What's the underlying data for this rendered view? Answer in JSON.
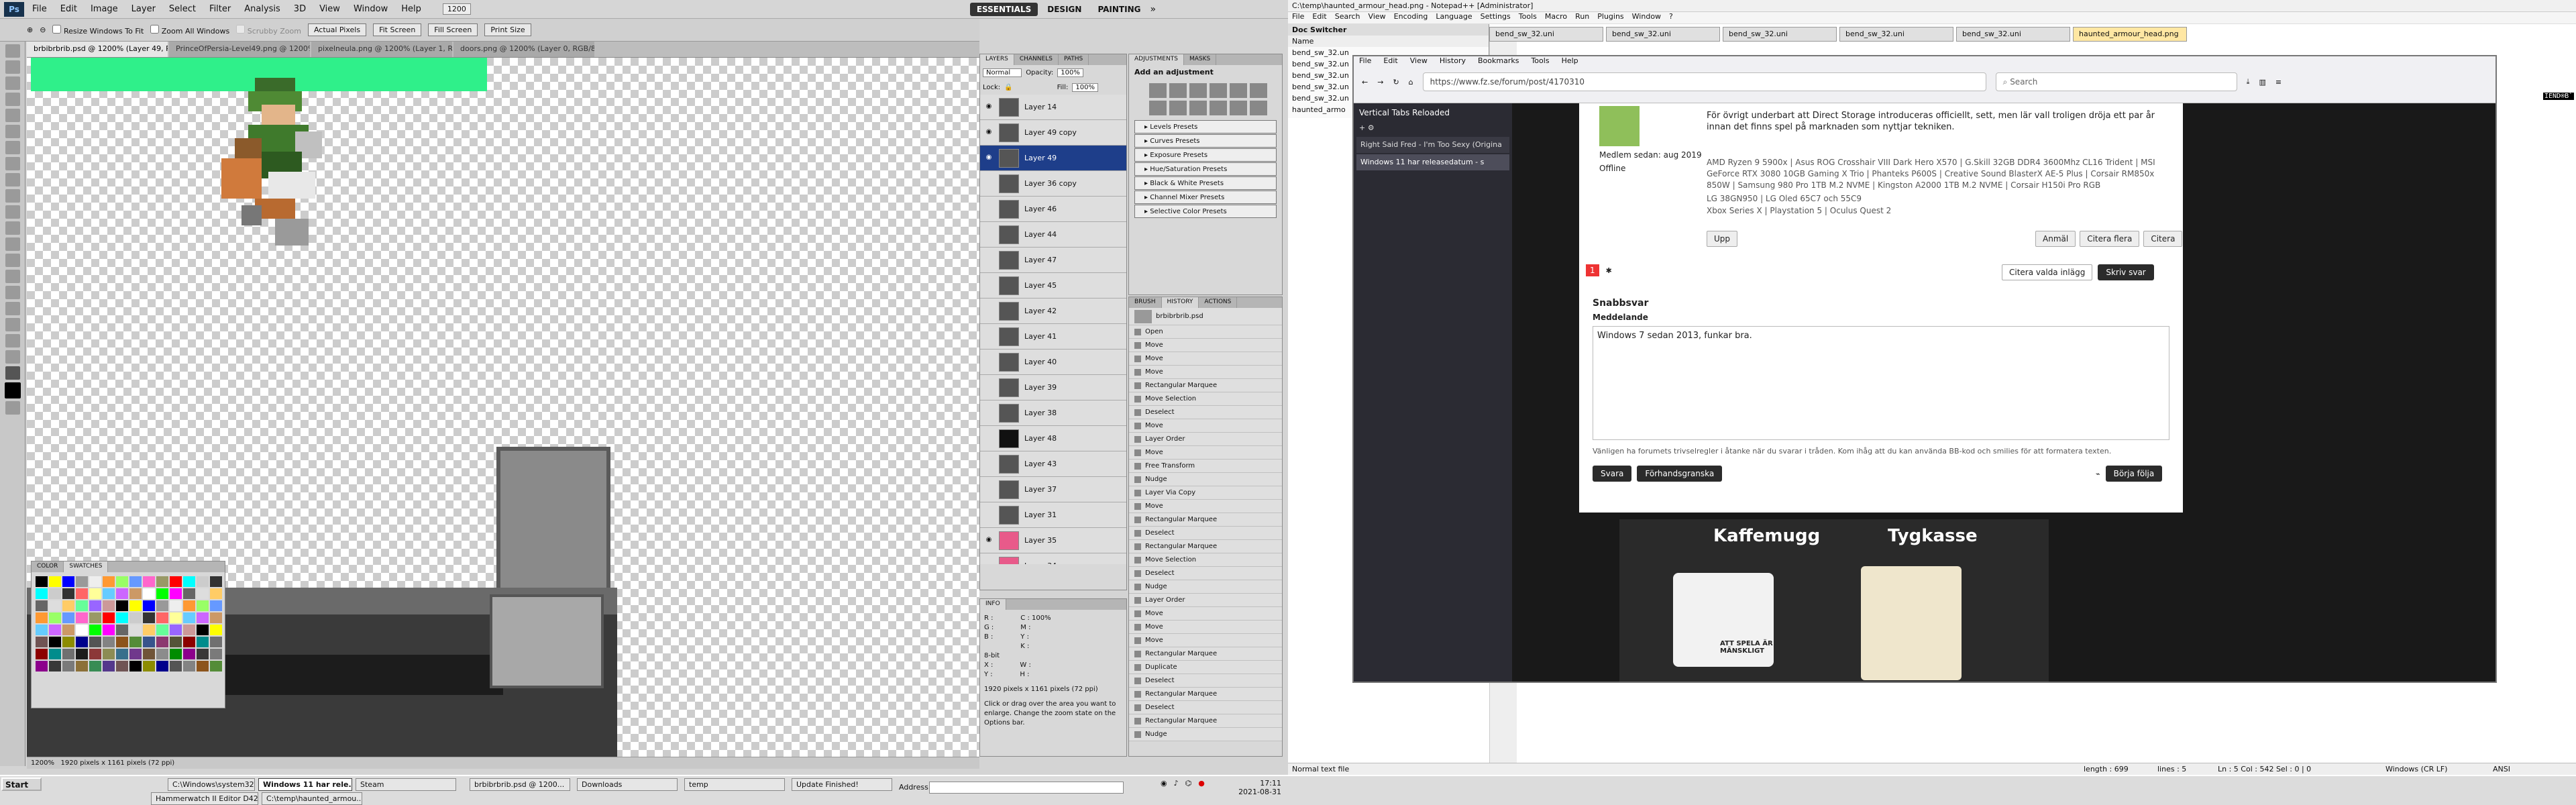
{
  "photoshop": {
    "menu": [
      "File",
      "Edit",
      "Image",
      "Layer",
      "Select",
      "Filter",
      "Analysis",
      "3D",
      "View",
      "Window",
      "Help"
    ],
    "zoom_value": "1200",
    "workspaces": [
      {
        "label": "ESSENTIALS",
        "active": true
      },
      {
        "label": "DESIGN"
      },
      {
        "label": "PAINTING"
      }
    ],
    "options": {
      "resize_windows": "Resize Windows To Fit",
      "zoom_all": "Zoom All Windows",
      "scrubby_zoom": "Scrubby Zoom",
      "actual_pixels": "Actual Pixels",
      "fit_screen": "Fit Screen",
      "fill_screen": "Fill Screen",
      "print_size": "Print Size"
    },
    "doc_tabs": [
      {
        "label": "brbibrbrib.psd @ 1200% (Layer 49, RGB/8) *",
        "active": true
      },
      {
        "label": "PrinceOfPersia-Level49.png @ 1200% (Layer...",
        "active": false
      },
      {
        "label": "pixelneula.png @ 1200% (Layer 1, RGB/8) *",
        "active": false
      },
      {
        "label": "doors.png @ 1200% (Layer 0, RGB/8) *",
        "active": false
      }
    ],
    "status_zoom": "1200%",
    "status_doc": "1920 pixels x 1161 pixels (72 ppi)",
    "color_panel": {
      "tab1": "COLOR",
      "tab2": "SWATCHES"
    },
    "layers_panel": {
      "tabs": [
        "LAYERS",
        "CHANNELS",
        "PATHS"
      ],
      "blend_mode": "Normal",
      "opacity_label": "Opacity:",
      "opacity": "100%",
      "lock_label": "Lock:",
      "fill_label": "Fill:",
      "fill": "100%",
      "layers": [
        {
          "name": "Layer 14",
          "visible": true
        },
        {
          "name": "Layer 49 copy",
          "visible": true
        },
        {
          "name": "Layer 49",
          "visible": true,
          "selected": true
        },
        {
          "name": "Layer 36 copy",
          "visible": false
        },
        {
          "name": "Layer 46",
          "visible": false
        },
        {
          "name": "Layer 44",
          "visible": false
        },
        {
          "name": "Layer 47",
          "visible": false
        },
        {
          "name": "Layer 45",
          "visible": false
        },
        {
          "name": "Layer 42",
          "visible": false
        },
        {
          "name": "Layer 41",
          "visible": false
        },
        {
          "name": "Layer 40",
          "visible": false
        },
        {
          "name": "Layer 39",
          "visible": false
        },
        {
          "name": "Layer 38",
          "visible": false
        },
        {
          "name": "Layer 48",
          "visible": false
        },
        {
          "name": "Layer 43",
          "visible": false
        },
        {
          "name": "Layer 37",
          "visible": false
        },
        {
          "name": "Layer 31",
          "visible": false
        },
        {
          "name": "Layer 35",
          "visible": true
        },
        {
          "name": "Layer 34",
          "visible": false
        }
      ]
    },
    "adjustments_panel": {
      "tabs": [
        "ADJUSTMENTS",
        "MASKS"
      ],
      "title": "Add an adjustment",
      "presets": [
        "Levels Presets",
        "Curves Presets",
        "Exposure Presets",
        "Hue/Saturation Presets",
        "Black & White Presets",
        "Channel Mixer Presets",
        "Selective Color Presets"
      ]
    },
    "history_panel": {
      "tabs": [
        "BRUSH",
        "HISTORY",
        "ACTIONS"
      ],
      "snapshot": "brbibrbrib.psd",
      "steps": [
        "Open",
        "Move",
        "Move",
        "Move",
        "Rectangular Marquee",
        "Move Selection",
        "Deselect",
        "Move",
        "Layer Order",
        "Move",
        "Free Transform",
        "Nudge",
        "Layer Via Copy",
        "Move",
        "Rectangular Marquee",
        "Deselect",
        "Rectangular Marquee",
        "Move Selection",
        "Deselect",
        "Nudge",
        "Layer Order",
        "Move",
        "Move",
        "Move",
        "Rectangular Marquee",
        "Duplicate",
        "Deselect",
        "Rectangular Marquee",
        "Deselect",
        "Rectangular Marquee",
        "Nudge",
        "Move"
      ]
    },
    "info_panel": {
      "tab": "INFO",
      "r": "R :",
      "g": "G :",
      "b": "B :",
      "c": "C :",
      "m": "M :",
      "y": "Y :",
      "k": "K :",
      "bit": "8-bit",
      "x": "X :",
      "y2": "Y :",
      "w": "W :",
      "h": "H :",
      "doc_size": "1920 pixels x 1161 pixels (72 ppi)",
      "hint": "Click or drag over the area you want to enlarge. Change the zoom state on the Options bar.",
      "val1": "100%"
    }
  },
  "notepad": {
    "title": "C:\\temp\\haunted_armour_head.png - Notepad++ [Administrator]",
    "menu": [
      "File",
      "Edit",
      "Search",
      "View",
      "Encoding",
      "Language",
      "Settings",
      "Tools",
      "Macro",
      "Run",
      "Plugins",
      "Window",
      "?"
    ],
    "doc_switcher_title": "Doc Switcher",
    "doc_switcher_name": "Name",
    "docs": [
      "bend_sw_32.un",
      "bend_sw_32.un",
      "bend_sw_32.un",
      "bend_sw_32.un",
      "bend_sw_32.un",
      "haunted_armo"
    ],
    "tabs": [
      {
        "label": "bend_sw_32.uni",
        "active": false
      },
      {
        "label": "bend_sw_32.uni",
        "active": false
      },
      {
        "label": "bend_sw_32.uni",
        "active": false
      },
      {
        "label": "bend_sw_32.uni",
        "active": false
      },
      {
        "label": "bend_sw_32.uni",
        "active": false
      },
      {
        "label": "haunted_armour_head.png",
        "active": true
      }
    ],
    "right_snippet": "IEND®B`",
    "status": {
      "type": "Normal text file",
      "length": "length : 699",
      "lines": "lines : 5",
      "pos": "Ln : 5   Col : 542   Sel : 0 | 0",
      "eol": "Windows (CR LF)",
      "enc": "ANSI"
    }
  },
  "firefox": {
    "menu": [
      "File",
      "Edit",
      "View",
      "History",
      "Bookmarks",
      "Tools",
      "Help"
    ],
    "url": "https://www.fz.se/forum/post/4170310",
    "search_placeholder": "Search",
    "vtabs_title": "Vertical Tabs Reloaded",
    "tabs": [
      {
        "label": "Right Said Fred - I'm Too Sexy (Origina",
        "active": false
      },
      {
        "label": "Windows 11 har releasedatum - s",
        "active": true
      }
    ],
    "post": {
      "text1": "För övrigt underbart att Direct Storage introduceras officiellt, sett, men lär vall troligen dröja ett par år innan det finns spel på marknaden som nyttjar tekniken.",
      "member_since": "Medlem sedan: aug 2019",
      "status": "Offline",
      "spec1": "AMD Ryzen 9 5900x | Asus ROG Crosshair VIII Dark Hero X570 | G.Skill 32GB DDR4 3600Mhz CL16 Trident | MSI GeForce RTX 3080 10GB Gaming X Trio | Phanteks P600S | Creative Sound BlasterX AE-5 Plus | Corsair RM850x 850W | Samsung 980 Pro 1TB M.2 NVME | Kingston A2000 1TB M.2 NVME | Corsair H150i Pro RGB",
      "spec2": "LG 38GN950 | LG Oled 65C7 och 55C9",
      "spec3": "Xbox Series X | Playstation 5 | Oculus Quest 2",
      "btn_report": "Anmäl",
      "btn_quote_more": "Citera flera",
      "btn_quote": "Citera",
      "btn_top": "Upp",
      "page_current": "1",
      "quote_select": "Citera valda inlägg",
      "btn_reply": "Skriv svar",
      "quick_reply": "Snabbsvar",
      "message_label": "Meddelande",
      "message_text": "Windows 7 sedan 2013, funkar bra.",
      "rules_text": "Vänligen ha forumets trivselregler i åtanke när du svarar i tråden. Kom ihåg att du kan använda BB-kod och smilies för att formatera texten.",
      "btn_submit": "Svara",
      "btn_preview": "Förhandsgranska",
      "btn_follow": "Börja följa"
    },
    "shop": {
      "item1": "Kaffemugg",
      "item2": "Tygkasse",
      "mug_text": "ATT SPELA ÄR MÄNSKLIGT"
    }
  },
  "taskbar": {
    "start": "Start",
    "tasks": [
      {
        "label": "C:\\Windows\\system32\\c...",
        "active": false
      },
      {
        "label": "Windows 11 har rele...",
        "active": true
      },
      {
        "label": "Steam",
        "active": false
      },
      {
        "label": "brbibrbrib.psd @ 1200...",
        "active": false
      },
      {
        "label": "Downloads",
        "active": false
      },
      {
        "label": "temp",
        "active": false
      },
      {
        "label": "Update Finished!",
        "active": false
      },
      {
        "label": "Hammerwatch II Editor D42",
        "active": false
      },
      {
        "label": "C:\\temp\\haunted_armou...",
        "active": false
      }
    ],
    "address_label": "Address",
    "time": "17:11",
    "date": "2021-08-31"
  }
}
